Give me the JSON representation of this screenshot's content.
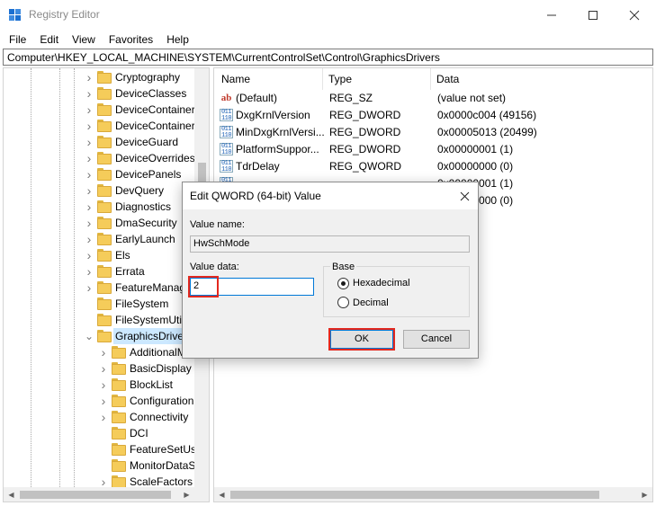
{
  "window": {
    "title": "Registry Editor",
    "icon": "registry-icon"
  },
  "menu": {
    "items": [
      "File",
      "Edit",
      "View",
      "Favorites",
      "Help"
    ]
  },
  "address": {
    "path": "Computer\\HKEY_LOCAL_MACHINE\\SYSTEM\\CurrentControlSet\\Control\\GraphicsDrivers"
  },
  "tree": {
    "items": [
      "Cryptography",
      "DeviceClasses",
      "DeviceContainerl",
      "DeviceContainers",
      "DeviceGuard",
      "DeviceOverrides",
      "DevicePanels",
      "DevQuery",
      "Diagnostics",
      "DmaSecurity",
      "EarlyLaunch",
      "Els",
      "Errata",
      "FeatureManag",
      "FileSystem",
      "FileSystemUtili",
      "GraphicsDriver",
      "AdditionalM",
      "BasicDisplay",
      "BlockList",
      "Configuration",
      "Connectivity",
      "DCI",
      "FeatureSetUsa",
      "MonitorDataS",
      "ScaleFactors"
    ],
    "selected": "GraphicsDriver"
  },
  "values": {
    "headers": {
      "name": "Name",
      "type": "Type",
      "data": "Data"
    },
    "rows": [
      {
        "icon": "string-value-icon",
        "name": "(Default)",
        "type": "REG_SZ",
        "data": "(value not set)"
      },
      {
        "icon": "binary-value-icon",
        "name": "DxgKrnlVersion",
        "type": "REG_DWORD",
        "data": "0x0000c004 (49156)"
      },
      {
        "icon": "binary-value-icon",
        "name": "MinDxgKrnlVersi...",
        "type": "REG_DWORD",
        "data": "0x00005013 (20499)"
      },
      {
        "icon": "binary-value-icon",
        "name": "PlatformSuppor...",
        "type": "REG_DWORD",
        "data": "0x00000001 (1)"
      },
      {
        "icon": "binary-value-icon",
        "name": "TdrDelay",
        "type": "REG_QWORD",
        "data": "0x00000000 (0)"
      },
      {
        "icon": "binary-value-icon",
        "name": "",
        "type": "",
        "data": "0x00000001 (1)"
      },
      {
        "icon": "binary-value-icon",
        "name": "",
        "type": "",
        "data": "0x00000000 (0)"
      }
    ]
  },
  "dialog": {
    "title": "Edit QWORD (64-bit) Value",
    "value_name_label": "Value name:",
    "value_name": "HwSchMode",
    "value_data_label": "Value data:",
    "value_data": "2",
    "base_label": "Base",
    "hex_label": "Hexadecimal",
    "dec_label": "Decimal",
    "selected_base": "Hexadecimal",
    "ok_label": "OK",
    "cancel_label": "Cancel"
  },
  "colors": {
    "highlight": "#e3281e",
    "accent": "#0078d7",
    "selection": "#cce8ff"
  }
}
